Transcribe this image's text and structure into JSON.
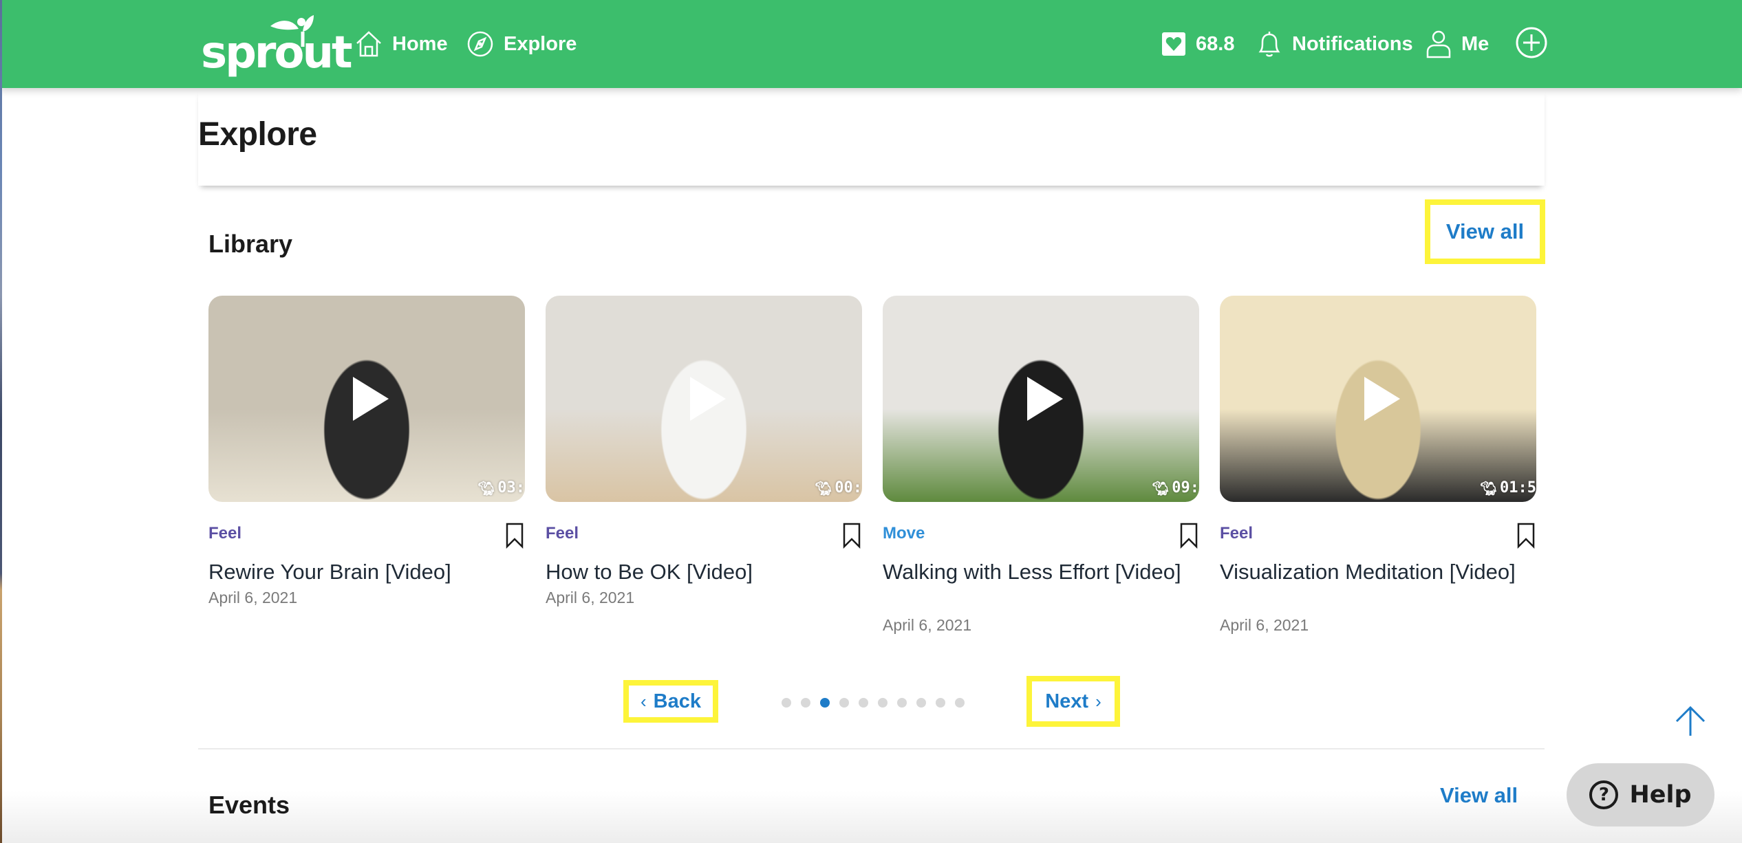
{
  "header": {
    "logo_text": "sprout",
    "nav": {
      "home_label": "Home",
      "explore_label": "Explore",
      "score_value": "68.8",
      "notifications_label": "Notifications",
      "me_label": "Me"
    },
    "brand_color": "#3cbe6c"
  },
  "page": {
    "title": "Explore"
  },
  "library": {
    "title": "Library",
    "view_all_label": "View all",
    "cards": [
      {
        "category": "Feel",
        "category_color": "#5b4fa3",
        "title": "Rewire Your Brain [Video]",
        "date": "April 6, 2021",
        "duration": "03:",
        "thumb_colors": [
          "#c9c2b3",
          "#2a2a2a",
          "#e7e1d2"
        ]
      },
      {
        "category": "Feel",
        "category_color": "#5b4fa3",
        "title": "How to Be OK [Video]",
        "date": "April 6, 2021",
        "duration": "00:",
        "thumb_colors": [
          "#e0ddd7",
          "#f4f4f2",
          "#d9c4a4"
        ]
      },
      {
        "category": "Move",
        "category_color": "#2f8fd8",
        "title": "Walking with Less Effort [Video]",
        "date": "April 6, 2021",
        "duration": "09:",
        "thumb_colors": [
          "#e6e4e0",
          "#1d1d1d",
          "#5f8a3e"
        ]
      },
      {
        "category": "Feel",
        "category_color": "#5b4fa3",
        "title": "Visualization Meditation [Video]",
        "date": "April 6, 2021",
        "duration": "01:5",
        "thumb_colors": [
          "#efe3c2",
          "#d8c79a",
          "#2a2a2a"
        ]
      }
    ],
    "pager": {
      "back_label": "Back",
      "next_label": "Next",
      "total_pages": 10,
      "current_page": 3
    }
  },
  "events": {
    "title": "Events",
    "view_all_label": "View all"
  },
  "help": {
    "label": "Help",
    "icon_glyph": "?"
  },
  "accent_color": "#1e7cc8",
  "highlight_color": "#fdf43a"
}
